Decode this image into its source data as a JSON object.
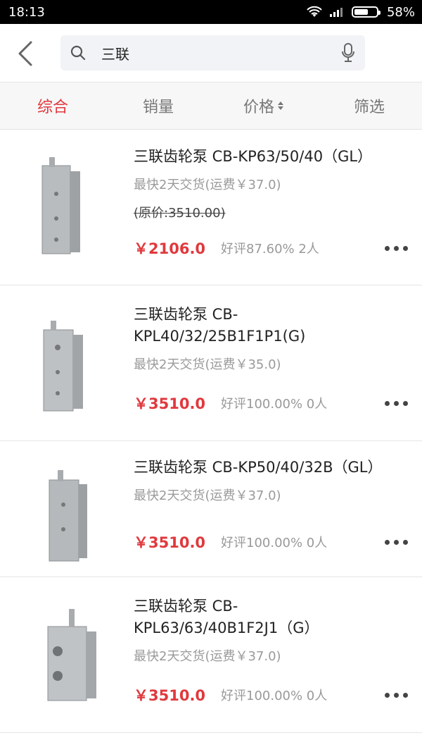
{
  "status_bar": {
    "time": "18:13",
    "battery": "58%"
  },
  "search": {
    "query": "三联"
  },
  "tabs": [
    {
      "label": "综合",
      "active": true
    },
    {
      "label": "销量",
      "active": false
    },
    {
      "label": "价格",
      "active": false
    },
    {
      "label": "筛选",
      "active": false
    }
  ],
  "products": [
    {
      "title": "三联齿轮泵 CB-KP63/50/40（GL）",
      "delivery": "最快2天交货(运费￥37.0)",
      "original_price": "(原价:3510.00)",
      "price": "￥2106.0",
      "rating": "好评87.60% 2人"
    },
    {
      "title_line1": "三联齿轮泵 CB-",
      "title_line2": "KPL40/32/25B1F1P1(G)",
      "delivery": "最快2天交货(运费￥35.0)",
      "price": "￥3510.0",
      "rating": "好评100.00% 0人"
    },
    {
      "title": "三联齿轮泵 CB-KP50/40/32B（GL）",
      "delivery": "最快2天交货(运费￥37.0)",
      "price": "￥3510.0",
      "rating": "好评100.00% 0人"
    },
    {
      "title_line1": "三联齿轮泵 CB-",
      "title_line2": "KPL63/63/40B1F2J1（G）",
      "delivery": "最快2天交货(运费￥37.0)",
      "price": "￥3510.0",
      "rating": "好评100.00% 0人"
    }
  ],
  "colors": {
    "accent": "#e0393d",
    "muted": "#9a9a9a"
  }
}
